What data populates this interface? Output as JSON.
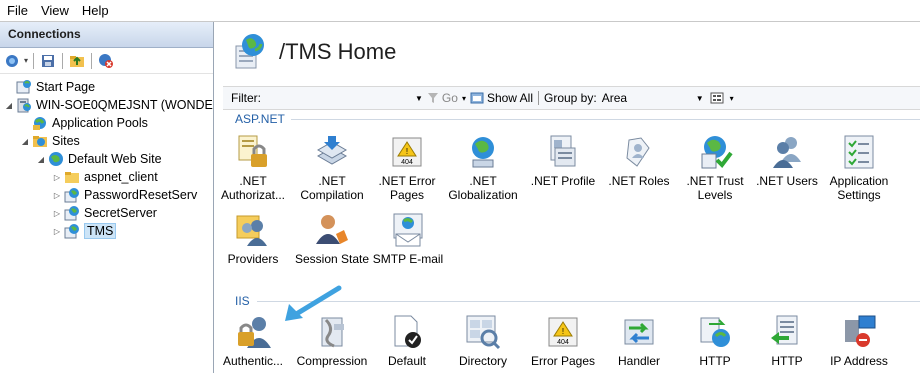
{
  "menu": [
    "File",
    "View",
    "Help"
  ],
  "connections": {
    "title": "Connections",
    "tree": [
      {
        "label": "Start Page",
        "indent": 0,
        "icon": "start-page-icon"
      },
      {
        "label": "WIN-SOE0QMEJSNT (WONDE",
        "indent": 0,
        "icon": "server-icon"
      },
      {
        "label": "Application Pools",
        "indent": 1,
        "icon": "app-pools-icon"
      },
      {
        "label": "Sites",
        "indent": 1,
        "icon": "sites-folder-icon"
      },
      {
        "label": "Default Web Site",
        "indent": 2,
        "icon": "globe-icon"
      },
      {
        "label": "aspnet_client",
        "indent": 3,
        "icon": "folder-icon"
      },
      {
        "label": "PasswordResetServ",
        "indent": 3,
        "icon": "app-icon"
      },
      {
        "label": "SecretServer",
        "indent": 3,
        "icon": "app-icon"
      },
      {
        "label": "TMS",
        "indent": 3,
        "icon": "app-icon",
        "selected": true
      }
    ]
  },
  "header": {
    "title": "/TMS Home"
  },
  "filter": {
    "label": "Filter:",
    "go": "Go",
    "show_all": "Show All",
    "group_by": "Group by:",
    "group_value": "Area"
  },
  "groups": {
    "aspnet": "ASP.NET",
    "iis": "IIS"
  },
  "aspnet_features": [
    {
      "l1": ".NET",
      "l2": "Authorizat...",
      "icon": "net-authorization-icon"
    },
    {
      "l1": ".NET",
      "l2": "Compilation",
      "icon": "net-compilation-icon"
    },
    {
      "l1": ".NET Error",
      "l2": "Pages",
      "icon": "net-error-pages-icon"
    },
    {
      "l1": ".NET",
      "l2": "Globalization",
      "icon": "net-globalization-icon"
    },
    {
      "l1": ".NET Profile",
      "l2": "",
      "icon": "net-profile-icon"
    },
    {
      "l1": ".NET Roles",
      "l2": "",
      "icon": "net-roles-icon"
    },
    {
      "l1": ".NET Trust",
      "l2": "Levels",
      "icon": "net-trust-levels-icon"
    },
    {
      "l1": ".NET Users",
      "l2": "",
      "icon": "net-users-icon"
    },
    {
      "l1": "Application",
      "l2": "Settings",
      "icon": "application-settings-icon"
    },
    {
      "l1": "Providers",
      "l2": "",
      "icon": "providers-icon"
    },
    {
      "l1": "Session State",
      "l2": "",
      "icon": "session-state-icon"
    },
    {
      "l1": "SMTP E-mail",
      "l2": "",
      "icon": "smtp-email-icon"
    }
  ],
  "iis_features": [
    {
      "l1": "Authentic...",
      "icon": "authentication-icon"
    },
    {
      "l1": "Compression",
      "icon": "compression-icon"
    },
    {
      "l1": "Default",
      "icon": "default-document-icon"
    },
    {
      "l1": "Directory",
      "icon": "directory-browsing-icon"
    },
    {
      "l1": "Error Pages",
      "icon": "error-pages-icon"
    },
    {
      "l1": "Handler",
      "icon": "handler-mappings-icon"
    },
    {
      "l1": "HTTP",
      "icon": "http-redirect-icon"
    },
    {
      "l1": "HTTP",
      "icon": "http-response-headers-icon"
    },
    {
      "l1": "IP Address",
      "icon": "ip-address-icon"
    }
  ]
}
